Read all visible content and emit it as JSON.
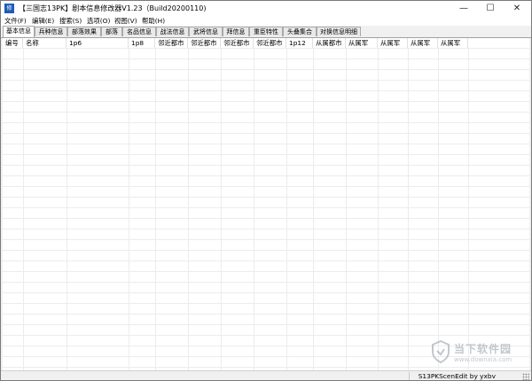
{
  "window": {
    "title": "【三国志13PK】剧本信息修改器V1.23（Build20200110)",
    "icon_text": "修"
  },
  "controls": {
    "minimize": "—",
    "maximize": "☐",
    "close": "✕"
  },
  "menu": [
    {
      "label": "文件(F)"
    },
    {
      "label": "编辑(E)"
    },
    {
      "label": "搜索(S)"
    },
    {
      "label": "选项(O)"
    },
    {
      "label": "视图(V)"
    },
    {
      "label": "帮助(H)"
    }
  ],
  "tabs": [
    {
      "label": "基本信息",
      "active": true
    },
    {
      "label": "兵种信息"
    },
    {
      "label": "部落效果"
    },
    {
      "label": "部落"
    },
    {
      "label": "名品信息"
    },
    {
      "label": "战法信息"
    },
    {
      "label": "武将信息"
    },
    {
      "label": "拜信息"
    },
    {
      "label": "重臣特性"
    },
    {
      "label": "头叠集合"
    },
    {
      "label": "对换信息明细"
    }
  ],
  "columns": [
    {
      "label": "编号"
    },
    {
      "label": "名称"
    },
    {
      "label": "1p6"
    },
    {
      "label": "1p8"
    },
    {
      "label": "邻近都市"
    },
    {
      "label": "邻近都市"
    },
    {
      "label": "邻近都市"
    },
    {
      "label": "邻近都市"
    },
    {
      "label": "1p12"
    },
    {
      "label": "从属都市"
    },
    {
      "label": "从属军"
    },
    {
      "label": "从属军"
    },
    {
      "label": "从属军"
    },
    {
      "label": "从属军"
    }
  ],
  "statusbar": {
    "text": "S13PKScenEdit by yxbv"
  },
  "watermark": {
    "title": "当下软件园",
    "url": "www.downxia.com"
  }
}
